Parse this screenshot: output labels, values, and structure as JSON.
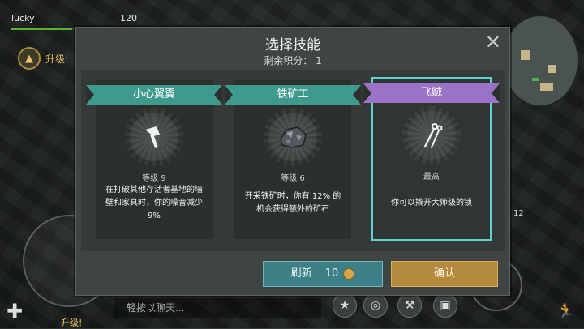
{
  "hud": {
    "player_name": "lucky",
    "hp_value": "120",
    "hp_fraction": 0.47,
    "level_up": "升级!",
    "level_up_bottom": "升级!",
    "chat_placeholder": "轻按以聊天...",
    "side_number": "12"
  },
  "dialog": {
    "title": "选择技能",
    "points_label": "剩余积分：",
    "points_value": "1",
    "close_icon": "close-icon"
  },
  "cards": [
    {
      "name": "小心翼翼",
      "level": "等级 9",
      "desc": "在打破其他存活者基地的墙壁和家具时，你的噪音减少 9%",
      "icon": "axe-icon",
      "ribbon_color": "#3f9a8e"
    },
    {
      "name": "铁矿工",
      "level": "等级 6",
      "desc": "开采铁矿时，你有 12% 的机会获得额外的矿石",
      "icon": "ore-icon",
      "ribbon_color": "#3f9a8e"
    },
    {
      "name": "飞贼",
      "level": "最高",
      "desc": "你可以撬开大师级的锁",
      "icon": "lockpick-icon",
      "ribbon_color": "#9a73c8"
    }
  ],
  "buttons": {
    "refresh_label": "刷新",
    "refresh_cost": "10",
    "confirm_label": "确认"
  },
  "colors": {
    "teal": "#3f9a8e",
    "purple": "#9a73c8",
    "selected_outline": "#5fd4cf",
    "confirm": "#b38a3e",
    "refresh": "#3d7f86"
  }
}
